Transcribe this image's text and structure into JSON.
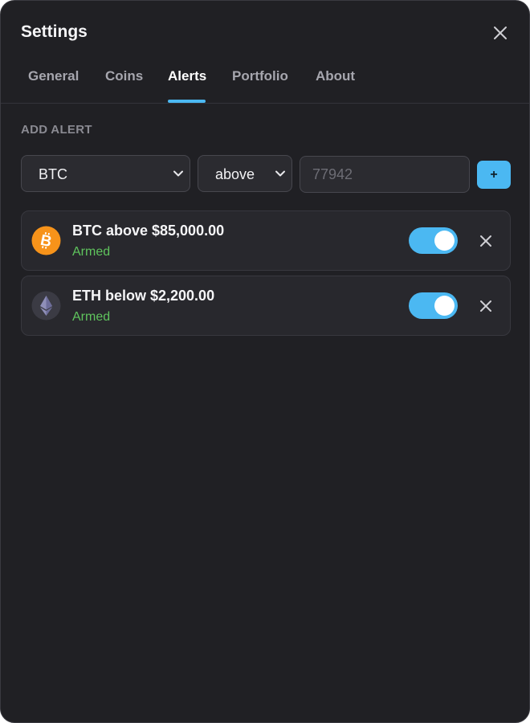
{
  "window": {
    "title": "Settings",
    "close_icon": "close-icon"
  },
  "tabs": [
    {
      "label": "General",
      "active": false
    },
    {
      "label": "Coins",
      "active": false
    },
    {
      "label": "Alerts",
      "active": true
    },
    {
      "label": "Portfolio",
      "active": false
    },
    {
      "label": "About",
      "active": false
    }
  ],
  "add_alert": {
    "section_label": "ADD ALERT",
    "coin_select": {
      "value": "BTC",
      "icon": "chevron-down-icon"
    },
    "condition_select": {
      "value": "above",
      "icon": "chevron-down-icon"
    },
    "price_input": {
      "value": "",
      "placeholder": "77942"
    },
    "add_button_label": "+"
  },
  "alerts": [
    {
      "coin": "BTC",
      "icon": "bitcoin-icon",
      "title": "BTC above $85,000.00",
      "status": "Armed",
      "enabled": true,
      "remove_icon": "close-icon"
    },
    {
      "coin": "ETH",
      "icon": "ethereum-icon",
      "title": "ETH below $2,200.00",
      "status": "Armed",
      "enabled": true,
      "remove_icon": "close-icon"
    }
  ],
  "colors": {
    "background": "#202024",
    "accent": "#4bb8f2",
    "status_armed": "#5fc45d",
    "bitcoin": "#f7931a",
    "card": "#28282d"
  }
}
